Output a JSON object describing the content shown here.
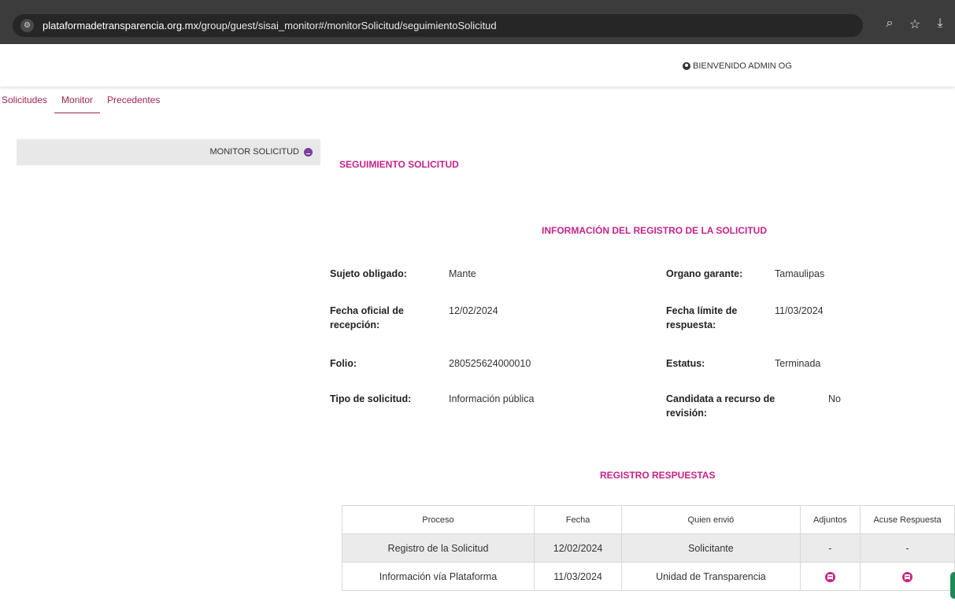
{
  "browser": {
    "url_host": "plataformadetransparencia.org.mx",
    "url_path": "/group/guest/sisai_monitor#/monitorSolicitud/seguimientoSolicitud"
  },
  "header": {
    "welcome": "BIENVENIDO ADMIN OG"
  },
  "nav": {
    "tabs": [
      {
        "label": "Solicitudes"
      },
      {
        "label": "Monitor"
      },
      {
        "label": "Precedentes"
      }
    ],
    "active": "Monitor"
  },
  "sidebar": {
    "item": "MONITOR SOLICITUD"
  },
  "main": {
    "title": "SEGUIMIENTO SOLICITUD",
    "section_title": "INFORMACIÓN DEL REGISTRO DE LA SOLICITUD",
    "fields": {
      "sujeto_label": "Sujeto obligado:",
      "sujeto_value": "Mante",
      "organo_label": "Organo garante:",
      "organo_value": "Tamaulipas",
      "fecha_oficial_label_1": "Fecha oficial de",
      "fecha_oficial_label_2": "recepción:",
      "fecha_oficial_value": "12/02/2024",
      "fecha_limite_label_1": "Fecha límite de",
      "fecha_limite_label_2": "respuesta:",
      "fecha_limite_value": "11/03/2024",
      "folio_label": "Folio:",
      "folio_value": "280525624000010",
      "estatus_label": "Estatus:",
      "estatus_value": "Terminada",
      "tipo_label": "Tipo de solicitud:",
      "tipo_value": "Información pública",
      "candidata_label_1": "Candidata a recurso de",
      "candidata_label_2": "revisión:",
      "candidata_value": "No"
    },
    "responses": {
      "title": "REGISTRO RESPUESTAS",
      "headers": [
        "Proceso",
        "Fecha",
        "Quien envió",
        "Adjuntos",
        "Acuse Respuesta"
      ],
      "rows": [
        {
          "proceso": "Registro de la Solicitud",
          "fecha": "12/02/2024",
          "quien": "Solicitante",
          "adjuntos": "-",
          "acuse": "-"
        },
        {
          "proceso": "Información vía Plataforma",
          "fecha": "11/03/2024",
          "quien": "Unidad de Transparencia",
          "adjuntos_icon": "document-icon",
          "acuse_icon": "document-icon"
        }
      ]
    }
  },
  "colors": {
    "accent": "#c7228a",
    "nav": "#9d2449",
    "sidebar_dot": "#7b3fa0"
  }
}
